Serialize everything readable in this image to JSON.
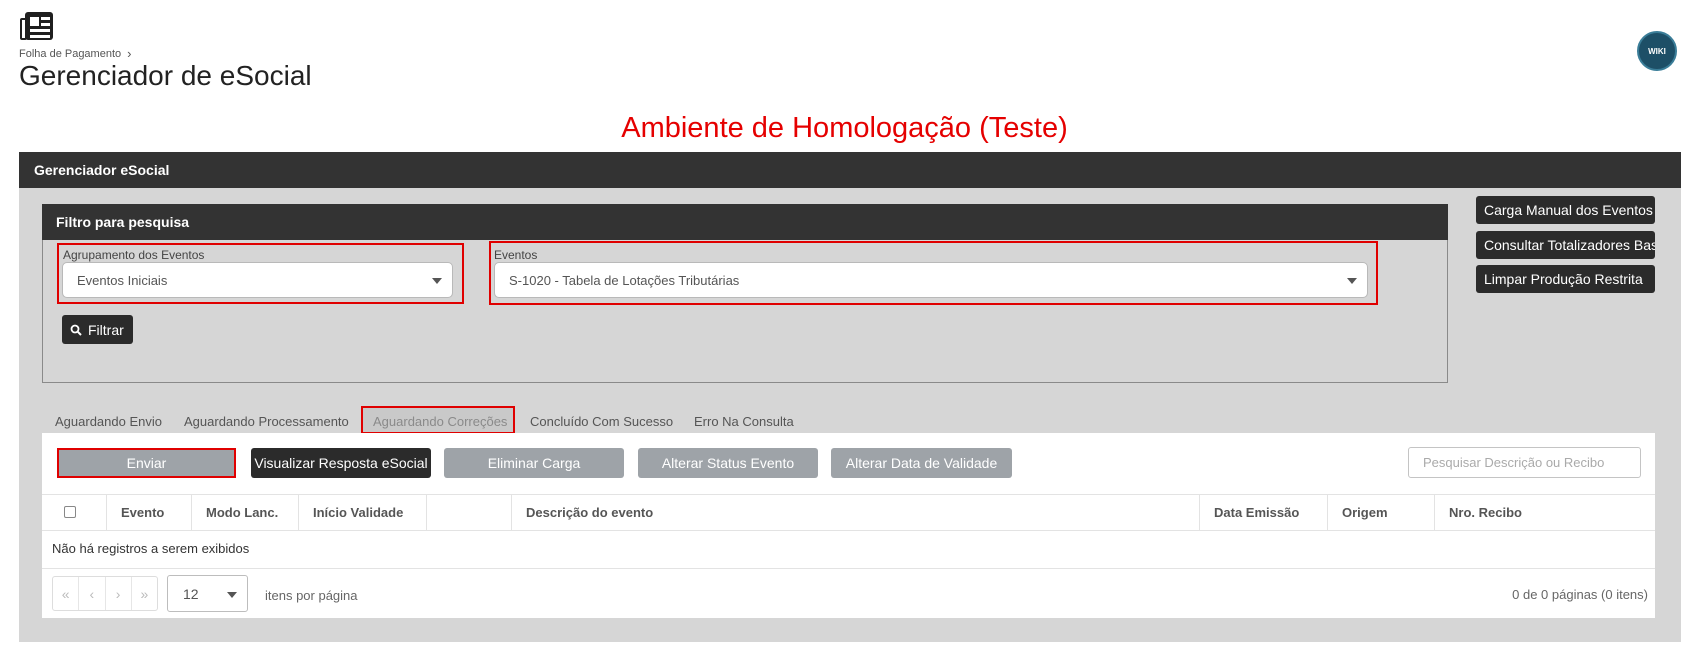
{
  "header": {
    "breadcrumb": "Folha de Pagamento",
    "title": "Gerenciador de eSocial",
    "wiki": "WIKI",
    "environment": "Ambiente de Homologação (Teste)"
  },
  "panel": {
    "title": "Gerenciador eSocial"
  },
  "filter": {
    "title": "Filtro para pesquisa",
    "group_label": "Agrupamento dos Eventos",
    "group_value": "Eventos Iniciais",
    "events_label": "Eventos",
    "events_value": "S-1020 - Tabela de Lotações Tributárias",
    "filter_button": "Filtrar"
  },
  "side_buttons": [
    "Carga Manual dos Eventos",
    "Consultar Totalizadores Base",
    "Limpar Produção Restrita"
  ],
  "tabs": [
    "Aguardando Envio",
    "Aguardando Processamento",
    "Aguardando Correções",
    "Concluído Com Sucesso",
    "Erro Na Consulta"
  ],
  "toolbar": {
    "send": "Enviar",
    "view_response": "Visualizar Resposta eSocial",
    "delete_load": "Eliminar Carga",
    "change_status": "Alterar Status Evento",
    "change_validity": "Alterar Data de Validade",
    "search_placeholder": "Pesquisar Descrição ou Recibo"
  },
  "grid": {
    "columns": [
      "Evento",
      "Modo Lanc.",
      "Início Validade",
      "",
      "Descrição do evento",
      "Data Emissão",
      "Origem",
      "Nro. Recibo"
    ],
    "empty_message": "Não há registros a serem exibidos",
    "page_size": "12",
    "per_page_label": "itens por página",
    "page_info": "0 de 0 páginas (0 itens)"
  },
  "colors": {
    "dark": "#333333",
    "environment_red": "#e50000",
    "highlight_red": "#e00000",
    "disabled_button": "#9ea3a8",
    "panel_bg": "#d6d6d6"
  }
}
